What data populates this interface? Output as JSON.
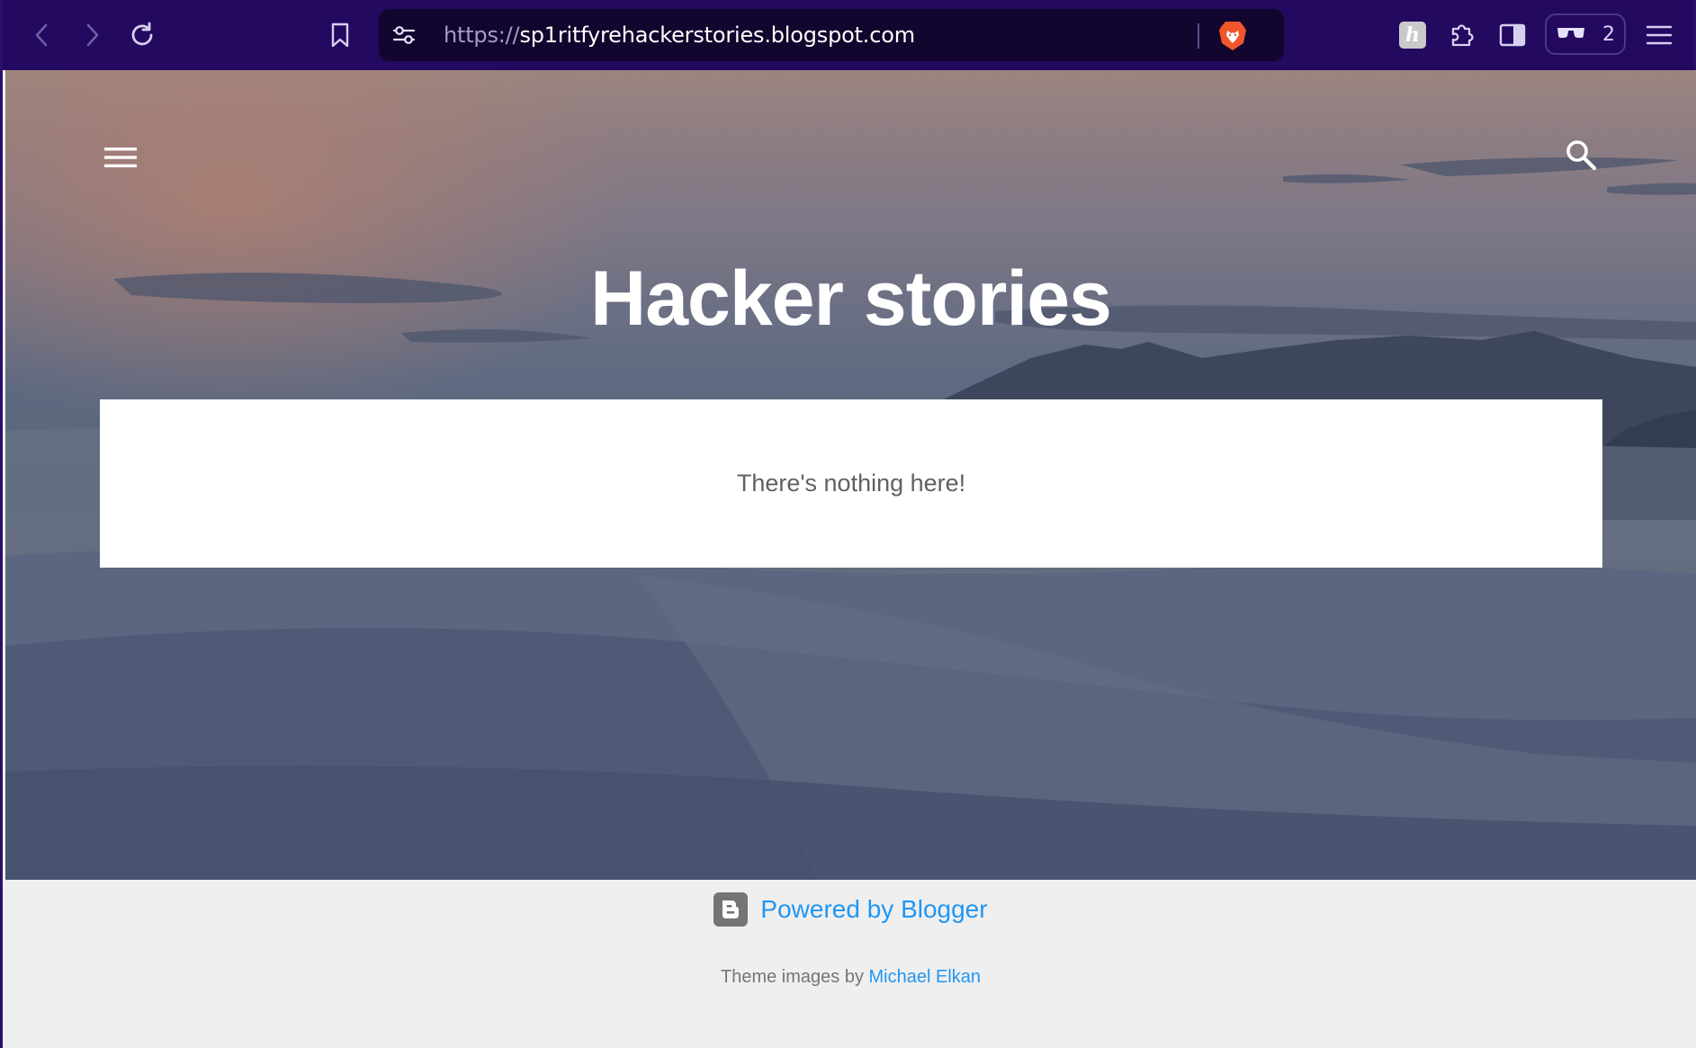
{
  "browser": {
    "url_scheme": "https://",
    "url_host": "sp1ritfyrehackerstories.blogspot.com",
    "reader_count": "2",
    "extension_letter": "h"
  },
  "blog": {
    "title": "Hacker stories",
    "empty_message": "There's nothing here!"
  },
  "footer": {
    "powered_by": "Powered by Blogger",
    "theme_prefix": "Theme images by ",
    "theme_author": "Michael Elkan"
  },
  "colors": {
    "toolbar": "#23095f",
    "link": "#2196f3",
    "brave": "#f0552b"
  }
}
